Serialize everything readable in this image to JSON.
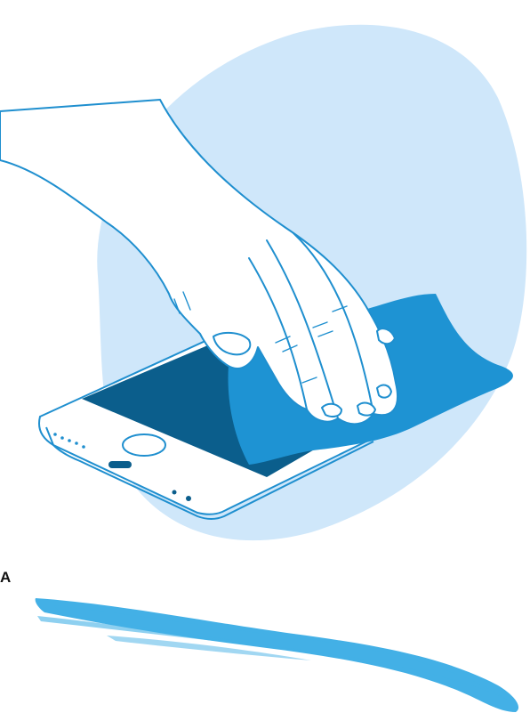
{
  "illustration": {
    "icon": "hand-cleaning-phone-illustration",
    "colors": {
      "blob": "#cfe7fa",
      "cloth": "#1e93d3",
      "outline": "#1f8fcf",
      "screen": "#0b5e8c",
      "stroke": "#43b0e6",
      "skin": "#ffffff"
    }
  },
  "corner_label": "A"
}
